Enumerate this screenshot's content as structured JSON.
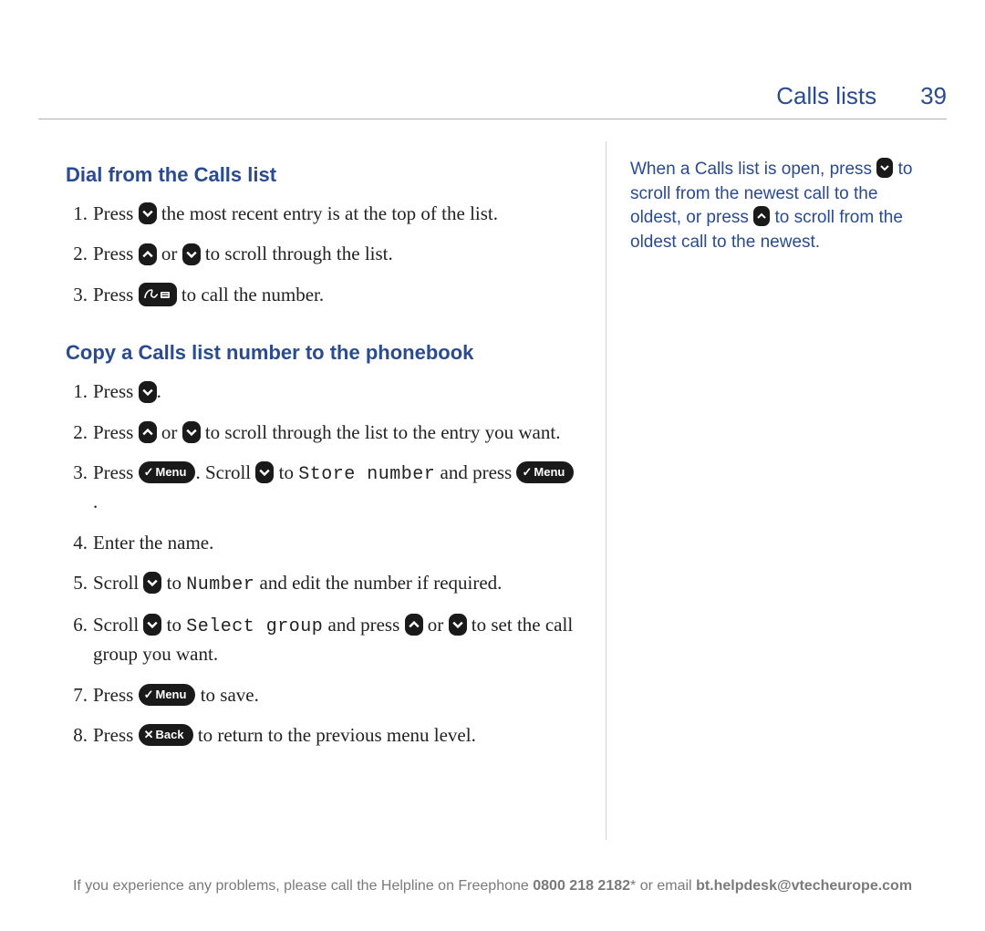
{
  "header": {
    "title": "Calls lists",
    "page": "39"
  },
  "section1": {
    "title": "Dial from the Calls list",
    "steps": {
      "s1a": "Press ",
      "s1b": " the most recent entry is at the top of the list.",
      "s2a": "Press ",
      "s2b": " or ",
      "s2c": " to scroll through the list.",
      "s3a": "Press ",
      "s3b": " to call the number."
    }
  },
  "section2": {
    "title": "Copy a Calls list number to the phonebook",
    "steps": {
      "s1a": "Press ",
      "s1b": ".",
      "s2a": "Press ",
      "s2b": " or ",
      "s2c": " to scroll through the list to the entry you want.",
      "s3a": "Press ",
      "s3b": ". Scroll ",
      "s3c": " to ",
      "s3_ocr1": "Store number",
      "s3d": " and press ",
      "s3e": ".",
      "s4": "Enter the name.",
      "s5a": "Scroll ",
      "s5b": " to ",
      "s5_ocr": "Number",
      "s5c": " and edit the number if required.",
      "s6a": "Scroll ",
      "s6b": " to ",
      "s6_ocr": "Select group",
      "s6c": " and press ",
      "s6d": " or ",
      "s6e": " to set the call group you want.",
      "s7a": "Press ",
      "s7b": " to save.",
      "s8a": "Press ",
      "s8b": " to return to the previous menu level."
    }
  },
  "buttons": {
    "menu": "Menu",
    "back": "Back"
  },
  "sidebar": {
    "t1": "When a Calls list is open, press ",
    "t2": " to scroll from the newest call to the oldest, or press ",
    "t3": " to scroll from the oldest call to the newest."
  },
  "footer": {
    "t1": "If you experience any problems, please call the Helpline on Freephone ",
    "phone": "0800 218 2182",
    "t2": "* or email ",
    "email": "bt.helpdesk@vtecheurope.com"
  }
}
